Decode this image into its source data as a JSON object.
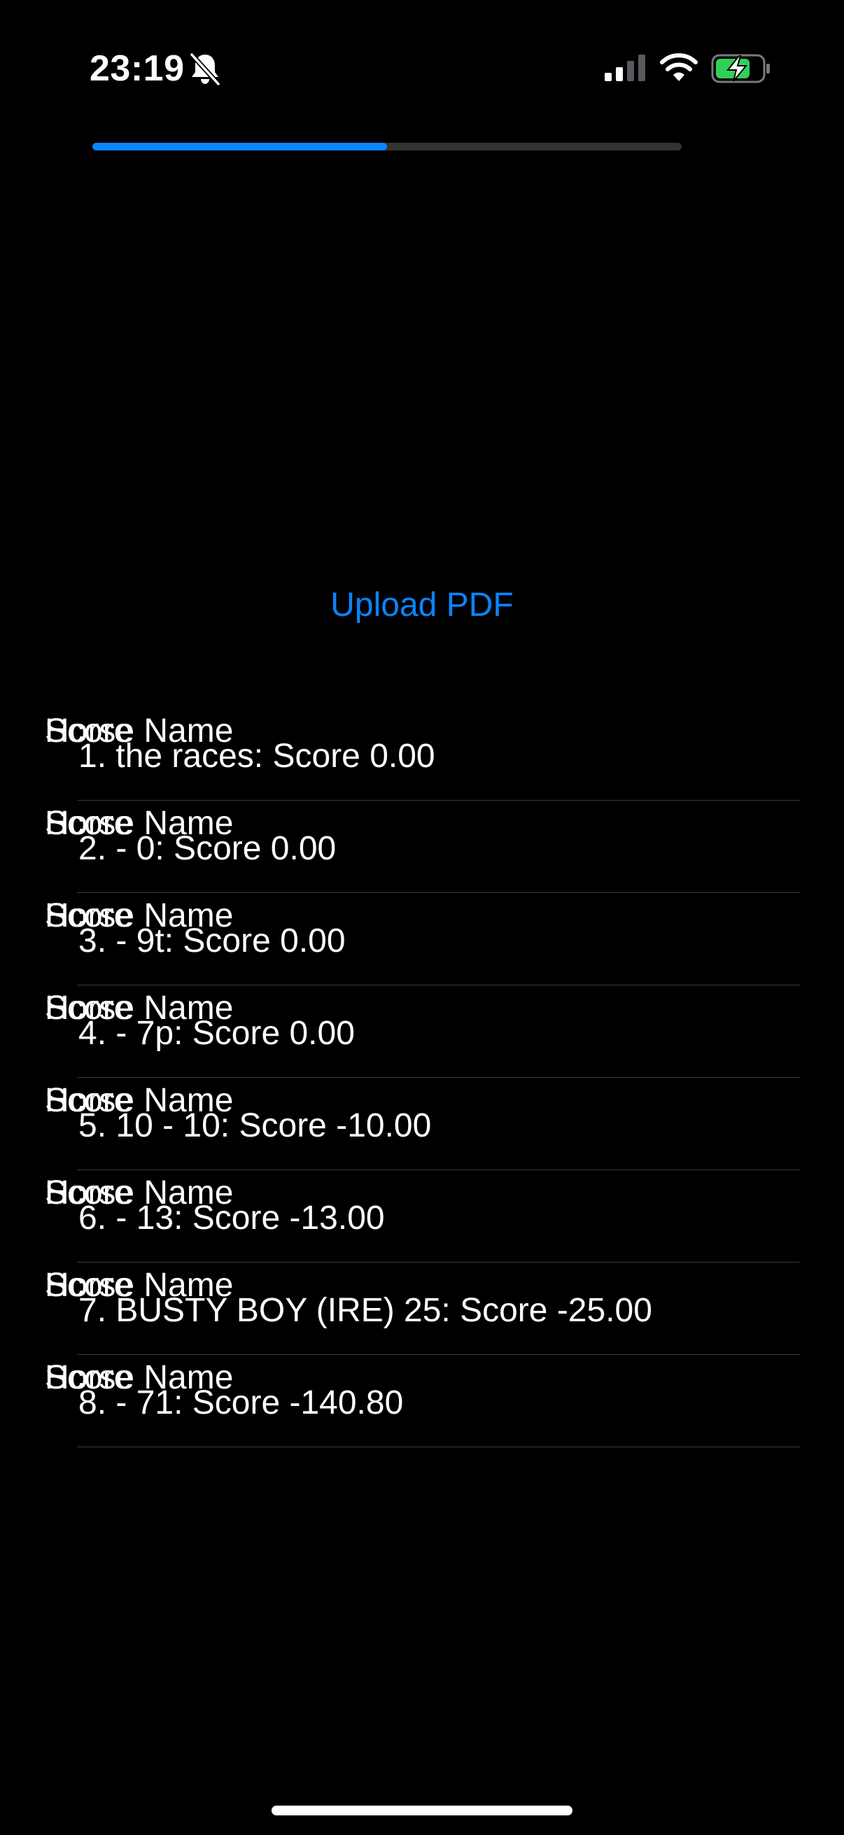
{
  "status_bar": {
    "time": "23:19",
    "icons": [
      "bell-slash-icon",
      "cellular-signal-icon",
      "wifi-icon",
      "battery-charging-icon"
    ],
    "battery_color": "#30d158"
  },
  "progress": {
    "value": 0.5,
    "fill_color": "#0a84ff",
    "track_color": "#333333"
  },
  "upload_button": {
    "label": "Upload PDF",
    "color": "#0a84ff"
  },
  "results": {
    "column_labels": {
      "horse_name": "Horse Name",
      "score": "Score"
    },
    "rows": [
      {
        "text": "1. the races: Score 0.00"
      },
      {
        "text": "2. - 0: Score 0.00"
      },
      {
        "text": "3. - 9t: Score 0.00"
      },
      {
        "text": "4. - 7p: Score 0.00"
      },
      {
        "text": "5. 10 - 10: Score -10.00"
      },
      {
        "text": "6. - 13: Score -13.00"
      },
      {
        "text": "7. BUSTY BOY (IRE) 25: Score -25.00"
      },
      {
        "text": "8. - 71: Score -140.80"
      }
    ]
  },
  "colors": {
    "background": "#000000",
    "text": "#ffffff",
    "divider": "#38383a"
  }
}
